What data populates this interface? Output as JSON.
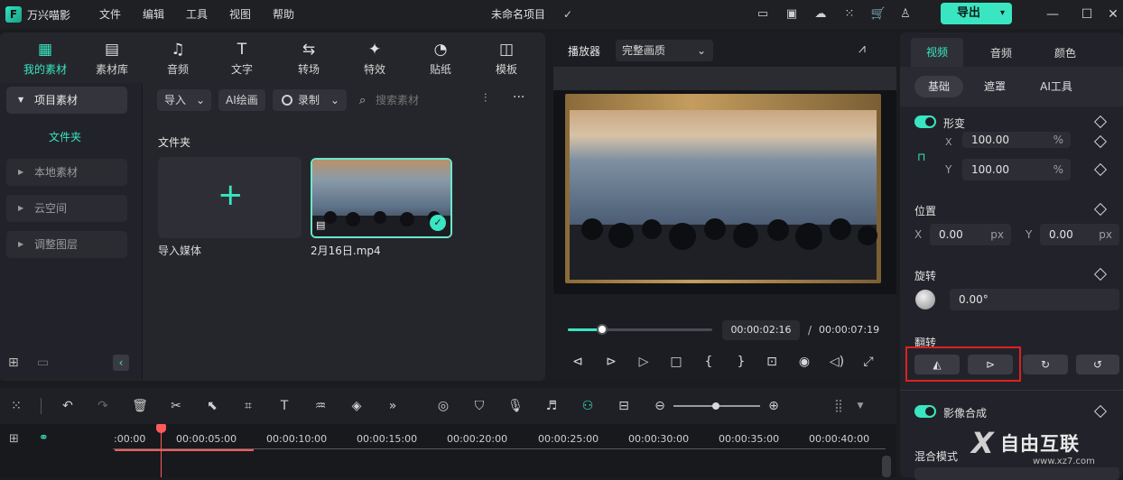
{
  "app": {
    "name": "万兴喵影",
    "project_title": "未命名项目",
    "export_label": "导出"
  },
  "menu": [
    "文件",
    "编辑",
    "工具",
    "视图",
    "帮助"
  ],
  "media_tabs": [
    {
      "label": "我的素材",
      "icon": "my-media-icon"
    },
    {
      "label": "素材库",
      "icon": "library-icon"
    },
    {
      "label": "音频",
      "icon": "music-icon"
    },
    {
      "label": "文字",
      "icon": "text-icon"
    },
    {
      "label": "转场",
      "icon": "transition-icon"
    },
    {
      "label": "特效",
      "icon": "effects-icon"
    },
    {
      "label": "贴纸",
      "icon": "sticker-icon"
    },
    {
      "label": "模板",
      "icon": "template-icon"
    }
  ],
  "sidebar": {
    "project_media": "项目素材",
    "folder": "文件夹",
    "items": [
      "本地素材",
      "云空间",
      "调整图层"
    ]
  },
  "media_toolbar": {
    "import": "导入",
    "ai_draw": "AI绘画",
    "record": "录制",
    "search_placeholder": "搜索素材"
  },
  "media_area": {
    "folder_title": "文件夹",
    "import_media_label": "导入媒体",
    "clip_name": "2月16日.mp4"
  },
  "player": {
    "label": "播放器",
    "quality": "完整画质",
    "current_time": "00:00:02:16",
    "separator": "/",
    "total_time": "00:00:07:19",
    "progress": 0.24
  },
  "right_tabs": [
    "视频",
    "音频",
    "颜色"
  ],
  "right_subtabs": [
    "基础",
    "遮罩",
    "AI工具"
  ],
  "properties": {
    "transform": "形变",
    "scale_x_label": "X",
    "scale_x": "100.00",
    "scale_y_label": "Y",
    "scale_y": "100.00",
    "percent": "%",
    "position": "位置",
    "pos_x_label": "X",
    "pos_x": "0.00",
    "pos_y_label": "Y",
    "pos_y": "0.00",
    "px": "px",
    "rotation": "旋转",
    "rotation_value": "0.00°",
    "flip": "翻转",
    "compositing": "影像合成",
    "blend_mode": "混合模式"
  },
  "timeline": {
    "ticks": [
      ":00:00",
      "00:00:05:00",
      "00:00:10:00",
      "00:00:15:00",
      "00:00:20:00",
      "00:00:25:00",
      "00:00:30:00",
      "00:00:35:00",
      "00:00:40:00"
    ]
  },
  "watermark": {
    "text": "自由互联",
    "url": "www.xz7.com"
  },
  "colors": {
    "accent": "#39e6c1",
    "highlight_box": "#e02020",
    "playhead": "#ff5a5a"
  }
}
